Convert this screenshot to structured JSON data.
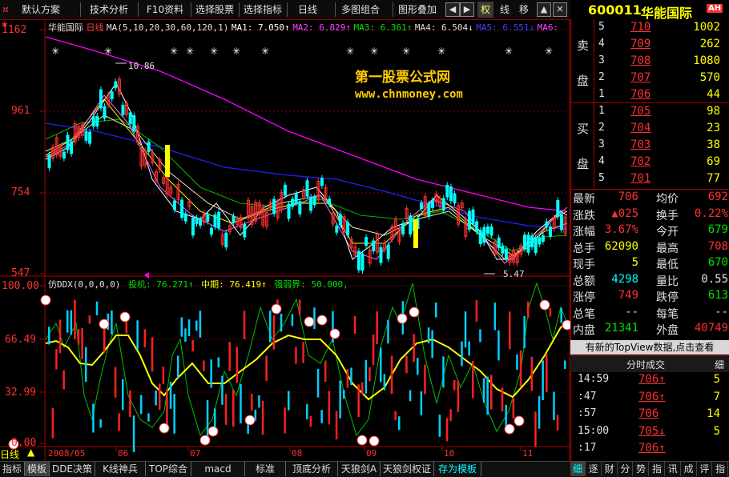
{
  "toolbar": {
    "items": [
      "默认方案",
      "技术分析",
      "F10资料",
      "选择股票",
      "选择指标",
      "日线",
      "多图组合",
      "图形叠加"
    ],
    "arrow_buttons": [
      "◀",
      "▶",
      "▲",
      "▼"
    ],
    "right_items": [
      "权",
      "线",
      "移"
    ],
    "close": "✕"
  },
  "header": {
    "code": "600011",
    "name": "华能国际",
    "badge": "AH"
  },
  "main_chart": {
    "price_labels": [
      "1162",
      "961",
      "754",
      "547"
    ],
    "title_stock": "华能国际",
    "title_period": "日线",
    "ma_params": "MA(5,10,20,30,60,120,1)",
    "ma1": "MA1: 7.050↑",
    "ma2": "MA2: 6.829↑",
    "ma3": "MA3: 6.361↑",
    "ma4": "MA4: 6.504↓",
    "ma5": "MA5: 6.551↓",
    "ma6": "MA6:",
    "high_mark": "10.86",
    "low_mark": "5.47",
    "watermark_title": "第一股票公式网",
    "watermark_url": "www.chnmoney.com"
  },
  "indicator": {
    "name": "仿DDX(0,0,0,0)",
    "v1": "投机: 76.271↑",
    "v2": "中期: 76.419↑",
    "v3": "强弱界: 50.000,",
    "levels": [
      "100.00",
      "66.49",
      "32.99",
      "0.00"
    ]
  },
  "dates": [
    "2008/05",
    "06",
    "07",
    "08",
    "09",
    "10",
    "11"
  ],
  "period_label": "日线",
  "bottom_tabs": [
    "指标",
    "模板",
    "DDE决策",
    "K线神兵",
    "TOP综合",
    "macd",
    "标准",
    "顶底分析",
    "天狼剑A",
    "天狼剑权证",
    "存为模板"
  ],
  "orderbook": {
    "sell_label_1": "卖",
    "sell_label_2": "盘",
    "buy_label_1": "买",
    "buy_label_2": "盘",
    "sells": [
      {
        "lvl": "5",
        "price": "710",
        "vol": "1002"
      },
      {
        "lvl": "4",
        "price": "709",
        "vol": "262"
      },
      {
        "lvl": "3",
        "price": "708",
        "vol": "1080"
      },
      {
        "lvl": "2",
        "price": "707",
        "vol": "570"
      },
      {
        "lvl": "1",
        "price": "706",
        "vol": "44"
      }
    ],
    "buys": [
      {
        "lvl": "1",
        "price": "705",
        "vol": "98"
      },
      {
        "lvl": "2",
        "price": "704",
        "vol": "23"
      },
      {
        "lvl": "3",
        "price": "703",
        "vol": "38"
      },
      {
        "lvl": "4",
        "price": "702",
        "vol": "69"
      },
      {
        "lvl": "5",
        "price": "701",
        "vol": "77"
      }
    ]
  },
  "quote": {
    "rows": [
      {
        "l1": "最新",
        "v1": "706",
        "l2": "均价",
        "v2": "692"
      },
      {
        "l1": "涨跌",
        "v1": "▲025",
        "l2": "换手",
        "v2": "0.22%"
      },
      {
        "l1": "涨幅",
        "v1": "3.67%",
        "l2": "今开",
        "v2": "679"
      },
      {
        "l1": "总手",
        "v1": "62090",
        "l2": "最高",
        "v2": "708"
      },
      {
        "l1": "现手",
        "v1": "5",
        "l2": "最低",
        "v2": "670"
      },
      {
        "l1": "总额",
        "v1": "4298",
        "l2": "量比",
        "v2": "0.55"
      },
      {
        "l1": "涨停",
        "v1": "749",
        "l2": "跌停",
        "v2": "613"
      },
      {
        "l1": "总笔",
        "v1": "--",
        "l2": "每笔",
        "v2": "--"
      },
      {
        "l1": "内盘",
        "v1": "21341",
        "l2": "外盘",
        "v2": "40749"
      }
    ]
  },
  "notice": "有新的TopView数据,点击查看",
  "ticks_header": "分时成交",
  "ticks_right": "细",
  "ticks": [
    {
      "t": "14:59",
      "p": "706↑",
      "v": "5"
    },
    {
      "t": ":47",
      "p": "706↑",
      "v": "7"
    },
    {
      "t": ":57",
      "p": "706",
      "v": "14"
    },
    {
      "t": "15:00",
      "p": "705↓",
      "v": "5"
    },
    {
      "t": ":17",
      "p": "706↑",
      "v": ""
    }
  ],
  "right_tabs": [
    "细",
    "逐",
    "财",
    "分",
    "势",
    "指",
    "讯",
    "成",
    "评",
    "指"
  ],
  "colors": {
    "up": "#ff3030",
    "down": "#00ffff",
    "ma_white": "#ffffff",
    "ma_yellow": "#ffff00",
    "ma_magenta": "#ff00ff",
    "ma_green": "#00c000",
    "ma_blue": "#2020ff"
  }
}
